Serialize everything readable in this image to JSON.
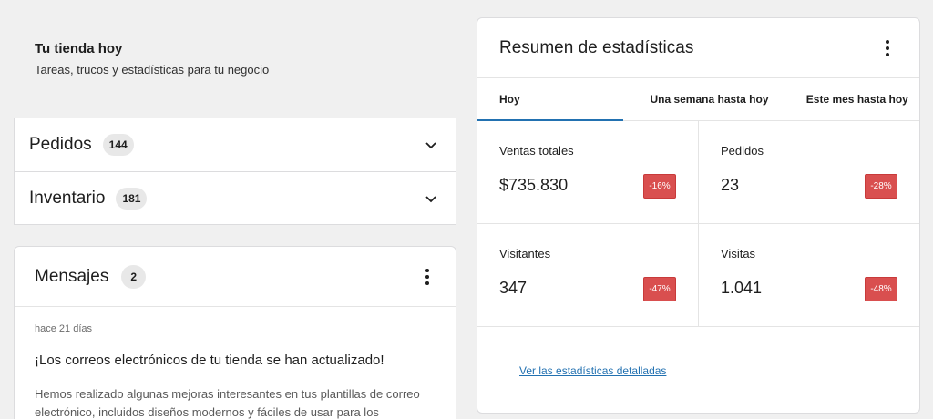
{
  "intro": {
    "title": "Tu tienda hoy",
    "subtitle": "Tareas, trucos y estadísticas para tu negocio"
  },
  "accordion": [
    {
      "label": "Pedidos",
      "count": "144",
      "icon": "chevron-down-icon"
    },
    {
      "label": "Inventario",
      "count": "181",
      "icon": "chevron-down-icon"
    }
  ],
  "messages": {
    "title": "Mensajes",
    "count": "2",
    "menu_icon": "kebab-menu-icon",
    "item": {
      "date": "hace 21 días",
      "headline": "¡Los correos electrónicos de tu tienda se han actualizado!",
      "text": "Hemos realizado algunas mejoras interesantes en tus plantillas de correo electrónico, incluidos diseños modernos y fáciles de usar para los"
    }
  },
  "stats": {
    "title": "Resumen de estadísticas",
    "menu_icon": "kebab-menu-icon",
    "tabs": [
      {
        "label": "Hoy",
        "active": true
      },
      {
        "label": "Una semana hasta hoy",
        "active": false
      },
      {
        "label": "Este mes hasta hoy",
        "active": false
      }
    ],
    "cells": [
      {
        "label": "Ventas totales",
        "value": "$735.830",
        "delta": "-16%"
      },
      {
        "label": "Pedidos",
        "value": "23",
        "delta": "-28%"
      },
      {
        "label": "Visitantes",
        "value": "347",
        "delta": "-47%"
      },
      {
        "label": "Visitas",
        "value": "1.041",
        "delta": "-48%"
      }
    ],
    "link": "Ver las estadísticas detalladas",
    "colors": {
      "delta_bg": "#d94f4f",
      "accent": "#2271b1"
    }
  }
}
